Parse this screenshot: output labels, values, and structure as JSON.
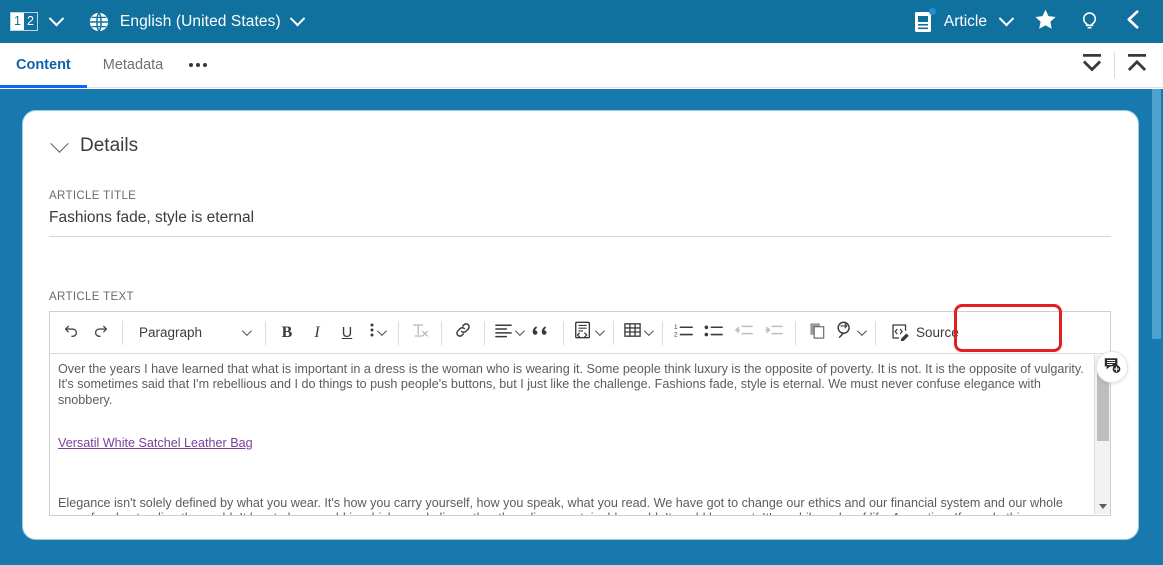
{
  "topbar": {
    "version_badge": {
      "current": "1",
      "other": "2",
      "name": "version-selector"
    },
    "language": "English (United States)",
    "content_type": "Article",
    "icons": {
      "globe": "globe-icon",
      "document": "document-icon",
      "favorite": "star-icon",
      "hint": "lightbulb-icon",
      "collapse_panel": "chevron-left-icon"
    }
  },
  "tabs": {
    "items": [
      {
        "label": "Content",
        "active": true
      },
      {
        "label": "Metadata",
        "active": false
      }
    ],
    "overflow_label": "...",
    "actions": {
      "collapse_all": "collapse-all-icon",
      "expand_all": "expand-all-icon"
    }
  },
  "details": {
    "section_title": "Details",
    "article_title_label": "ARTICLE TITLE",
    "article_title_value": "Fashions fade, style is eternal",
    "article_text_label": "ARTICLE TEXT"
  },
  "toolbar": {
    "undo": "Undo",
    "redo": "Redo",
    "paragraph_format": "Paragraph",
    "bold": "B",
    "italic": "I",
    "underline": "U",
    "more_formatting": "More formatting",
    "remove_format": "Remove format",
    "link": "Link",
    "alignment": "Text alignment",
    "blockquote": "Block quote",
    "html_embed": "HTML embed",
    "table": "Insert table",
    "numbered_list": "Numbered list",
    "bulleted_list": "Bulleted list",
    "outdent": "Decrease indent",
    "indent": "Increase indent",
    "paste": "Paste from office",
    "find_replace": "Find and replace",
    "source_label": "Source",
    "source_highlight_color": "#e02020"
  },
  "editor_content": {
    "paragraph_1": "Over the years I have learned that what is important in a dress is the woman who is wearing it. Some people think luxury is the opposite of poverty. It is not. It is the opposite of vulgarity. It's sometimes said that I'm rebellious and I do things to push people's buttons, but I just like the challenge. Fashions fade, style is eternal. We must never confuse elegance with snobbery.",
    "link_text": "Versatil White Satchel Leather Bag",
    "link_color": "#7b3f98",
    "paragraph_2": "Elegance isn't solely defined by what you wear. It's how you carry yourself, how you speak, what you read. We have got to change our ethics and our financial system and our whole way of understanding the world. It has to be a world in which people live rather than die; a sustainable world. It could be great. It's a philosophy of life. A practice. If you do this, something will change, what will change is that you will change, your life will change, and if you can change you, you can perhaps change the world. I've treated the waistcoat as if"
  },
  "comment": {
    "icon": "add-comment-icon"
  },
  "colors": {
    "header_blue": "#10719e",
    "page_blue": "#1779ad",
    "accent": "#0f62fe",
    "card_border": "#9ecbe4"
  }
}
